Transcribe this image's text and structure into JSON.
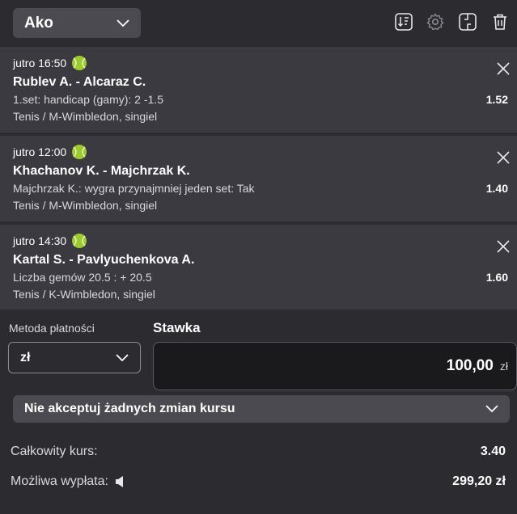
{
  "header": {
    "bet_type": "Ako",
    "tools": [
      "sort-icon",
      "settings-icon",
      "collapse-icon",
      "trash-icon"
    ]
  },
  "bets": [
    {
      "time": "jutro 16:50",
      "match": "Rublev A. - Alcaraz C.",
      "market": "1.set: handicap (gamy): 2 -1.5",
      "league": "Tenis / M-Wimbledon, singiel",
      "odds": "1.52"
    },
    {
      "time": "jutro 12:00",
      "match": "Khachanov K. - Majchrzak K.",
      "market": "Majchrzak K.: wygra przynajmniej jeden set: Tak",
      "league": "Tenis / M-Wimbledon, singiel",
      "odds": "1.40"
    },
    {
      "time": "jutro 14:30",
      "match": "Kartal S. - Pavlyuchenkova A.",
      "market": "Liczba gemów 20.5 : + 20.5",
      "league": "Tenis / K-Wimbledon, singiel",
      "odds": "1.60"
    }
  ],
  "stake": {
    "payment_label": "Metoda płatności",
    "payment_value": "zł",
    "stake_label": "Stawka",
    "stake_value": "100,00",
    "currency": "zł",
    "accept_changes": "Nie akceptuj żadnych zmian kursu"
  },
  "summary": {
    "total_odds_label": "Całkowity kurs:",
    "total_odds": "3.40",
    "payout_label": "Możliwa wypłata:",
    "payout": "299,20 zł"
  },
  "colors": {
    "background": "#2b2b30",
    "card": "#3a3a40",
    "tennis_ball": "#9ccc2b"
  }
}
